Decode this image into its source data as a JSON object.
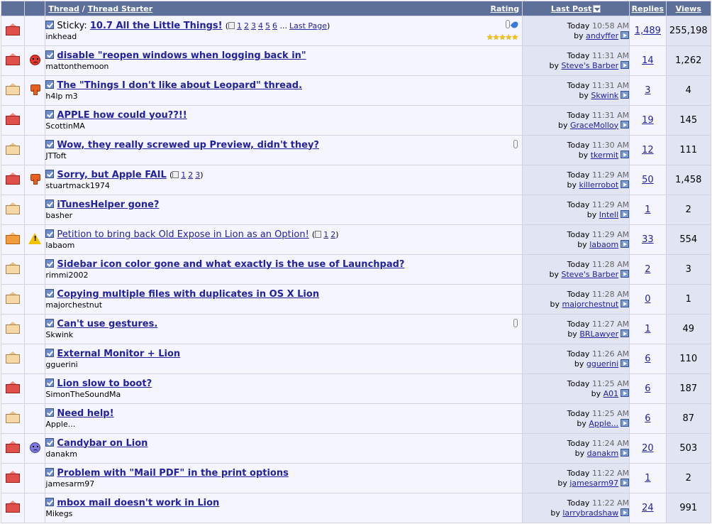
{
  "header": {
    "thread": "Thread",
    "separator": "/",
    "thread_starter": "Thread Starter",
    "rating": "Rating",
    "last_post": "Last Post",
    "replies": "Replies",
    "views": "Views"
  },
  "threads": [
    {
      "icon": "hot",
      "posticon": "",
      "sticky": "Sticky:",
      "title": "10.7 All the Little Things!",
      "bold": true,
      "pages": [
        "1",
        "2",
        "3",
        "4",
        "5",
        "6"
      ],
      "ellipsis": "...",
      "last_page": "Last Page",
      "starter": "inkhead",
      "attach": true,
      "pinned": true,
      "stars": "★★★★★",
      "day": "Today",
      "time": "10:58 AM",
      "by": "by",
      "last_user": "andyffer",
      "replies": "1,489",
      "views": "255,198"
    },
    {
      "icon": "hot",
      "posticon": "angry",
      "title": "disable \"reopen windows when logging back in\"",
      "bold": true,
      "starter": "mattonthemoon",
      "day": "Today",
      "time": "11:31 AM",
      "by": "by",
      "last_user": "Steve's Barber",
      "replies": "14",
      "views": "1,262"
    },
    {
      "icon": "new",
      "posticon": "thumbsdown",
      "title": "The \"Things I don't like about Leopard\" thread.",
      "bold": true,
      "starter": "h4lp m3",
      "day": "Today",
      "time": "11:31 AM",
      "by": "by",
      "last_user": "Skwink",
      "replies": "3",
      "views": "4"
    },
    {
      "icon": "hot",
      "posticon": "",
      "title": "APPLE how could you??!!",
      "bold": true,
      "starter": "ScottinMA",
      "day": "Today",
      "time": "11:31 AM",
      "by": "by",
      "last_user": "GraceMolloy",
      "replies": "19",
      "views": "145"
    },
    {
      "icon": "new",
      "posticon": "",
      "title": "Wow, they really screwed up Preview, didn't they?",
      "bold": true,
      "starter": "JTToft",
      "attach": true,
      "day": "Today",
      "time": "11:30 AM",
      "by": "by",
      "last_user": "tkermit",
      "replies": "12",
      "views": "111"
    },
    {
      "icon": "hot",
      "posticon": "thumbsdown",
      "title": "Sorry, but Apple FAIL",
      "bold": true,
      "pages": [
        "1",
        "2",
        "3"
      ],
      "starter": "stuartmack1974",
      "day": "Today",
      "time": "11:29 AM",
      "by": "by",
      "last_user": "killerrobot",
      "replies": "50",
      "views": "1,458"
    },
    {
      "icon": "new",
      "posticon": "",
      "title": "iTunesHelper gone?",
      "bold": true,
      "starter": "basher",
      "day": "Today",
      "time": "11:29 AM",
      "by": "by",
      "last_user": "Intell",
      "replies": "1",
      "views": "2"
    },
    {
      "icon": "orange",
      "posticon": "warning",
      "title": "Petition to bring back Old Expose in Lion as an Option!",
      "bold": false,
      "pages": [
        "1",
        "2"
      ],
      "starter": "labaom",
      "day": "Today",
      "time": "11:29 AM",
      "by": "by",
      "last_user": "labaom",
      "replies": "33",
      "views": "554"
    },
    {
      "icon": "new",
      "posticon": "",
      "title": "Sidebar icon color gone and what exactly is the use of Launchpad?",
      "bold": true,
      "starter": "rimmi2002",
      "day": "Today",
      "time": "11:28 AM",
      "by": "by",
      "last_user": "Steve's Barber",
      "replies": "2",
      "views": "3"
    },
    {
      "icon": "new",
      "posticon": "",
      "title": "Copying multiple files with duplicates in OS X Lion",
      "bold": true,
      "starter": "majorchestnut",
      "day": "Today",
      "time": "11:28 AM",
      "by": "by",
      "last_user": "majorchestnut",
      "replies": "0",
      "views": "1"
    },
    {
      "icon": "new",
      "posticon": "",
      "title": "Can't use gestures.",
      "bold": true,
      "starter": "Skwink",
      "attach": true,
      "day": "Today",
      "time": "11:27 AM",
      "by": "by",
      "last_user": "BRLawyer",
      "replies": "1",
      "views": "49"
    },
    {
      "icon": "new",
      "posticon": "",
      "title": "External Monitor + Lion",
      "bold": true,
      "starter": "gguerini",
      "day": "Today",
      "time": "11:26 AM",
      "by": "by",
      "last_user": "gguerini",
      "replies": "6",
      "views": "110"
    },
    {
      "icon": "hot",
      "posticon": "",
      "title": "Lion slow to boot?",
      "bold": true,
      "starter": "SimonTheSoundMa",
      "day": "Today",
      "time": "11:25 AM",
      "by": "by",
      "last_user": "A01",
      "replies": "6",
      "views": "187"
    },
    {
      "icon": "new",
      "posticon": "",
      "title": "Need help!",
      "bold": true,
      "starter": "Apple...",
      "day": "Today",
      "time": "11:25 AM",
      "by": "by",
      "last_user": "Apple...",
      "replies": "6",
      "views": "87"
    },
    {
      "icon": "hot",
      "posticon": "sad",
      "title": "Candybar on Lion",
      "bold": true,
      "starter": "danakm",
      "day": "Today",
      "time": "11:24 AM",
      "by": "by",
      "last_user": "danakm",
      "replies": "20",
      "views": "503"
    },
    {
      "icon": "hot",
      "posticon": "",
      "title": "Problem with \"Mail PDF\" in the print options",
      "bold": true,
      "starter": "jamesarm97",
      "day": "Today",
      "time": "11:22 AM",
      "by": "by",
      "last_user": "jamesarm97",
      "replies": "1",
      "views": "2"
    },
    {
      "icon": "hot",
      "posticon": "",
      "title": "mbox mail doesn't work in Lion",
      "bold": true,
      "starter": "Mikegs",
      "day": "Today",
      "time": "11:22 AM",
      "by": "by",
      "last_user": "larrybradshaw",
      "replies": "24",
      "views": "991"
    }
  ]
}
